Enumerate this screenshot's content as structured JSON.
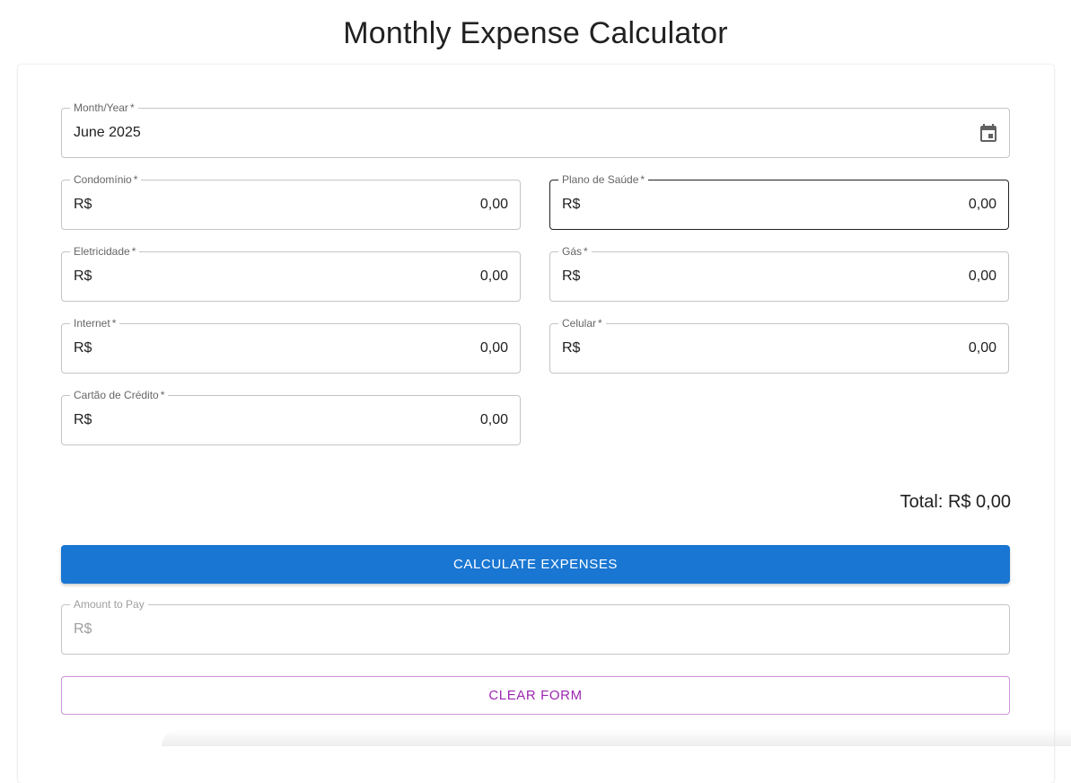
{
  "page": {
    "title": "Monthly Expense Calculator"
  },
  "form": {
    "month": {
      "label": "Month/Year",
      "required_mark": "*",
      "value": "June 2025",
      "icon": "calendar-icon"
    },
    "currency_prefix": "R$",
    "fields": [
      {
        "key": "condominio",
        "label": "Condomínio",
        "value": "0,00"
      },
      {
        "key": "plano_saude",
        "label": "Plano de Saúde",
        "value": "0,00"
      },
      {
        "key": "eletricidade",
        "label": "Eletricidade",
        "value": "0,00"
      },
      {
        "key": "gas",
        "label": "Gás",
        "value": "0,00"
      },
      {
        "key": "internet",
        "label": "Internet",
        "value": "0,00"
      },
      {
        "key": "celular",
        "label": "Celular",
        "value": "0,00"
      },
      {
        "key": "cartao_credito",
        "label": "Cartão de Crédito",
        "value": "0,00"
      }
    ],
    "total_text": "Total: R$ 0,00",
    "calculate_label": "CALCULATE EXPENSES",
    "amount_to_pay": {
      "label": "Amount to Pay",
      "prefix": "R$"
    },
    "clear_label": "CLEAR FORM"
  },
  "colors": {
    "primary": "#1976d2",
    "secondary": "#9c27b0",
    "border": "#c4c4c4",
    "focused_border": "#212121"
  }
}
